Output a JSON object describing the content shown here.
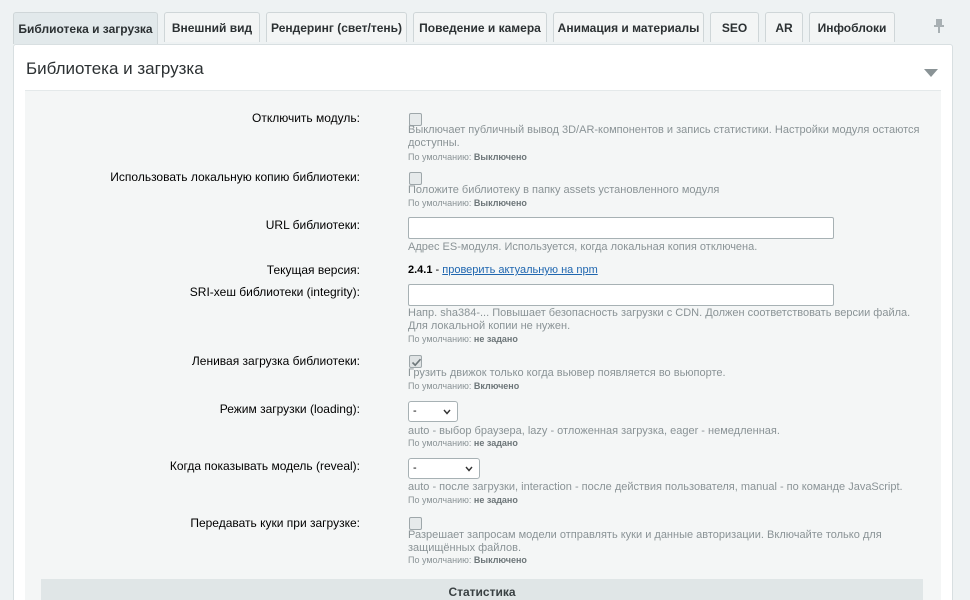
{
  "tabs": [
    {
      "label": "Библиотека и загрузка",
      "active": true
    },
    {
      "label": "Внешний вид"
    },
    {
      "label": "Рендеринг (свет/тень)"
    },
    {
      "label": "Поведение и камера"
    },
    {
      "label": "Анимация и материалы"
    },
    {
      "label": "SEO"
    },
    {
      "label": "AR"
    },
    {
      "label": "Инфоблоки"
    }
  ],
  "panel": {
    "title": "Библиотека и загрузка"
  },
  "default_prefix": "По умолчанию:",
  "fields": {
    "disable_module": {
      "label": "Отключить модуль:",
      "checked": false,
      "desc": "Выключает публичный вывод 3D/AR-компонентов и запись статистики. Настройки модуля остаются доступны.",
      "default": "Выключено"
    },
    "local_copy": {
      "label": "Использовать локальную копию библиотеки:",
      "checked": false,
      "desc": "Положите библиотеку в папку assets установленного модуля",
      "default": "Выключено"
    },
    "library_url": {
      "label": "URL библиотеки:",
      "value": "",
      "desc": "Адрес ES-модуля. Используется, когда локальная копия отключена."
    },
    "current_version": {
      "label": "Текущая версия:",
      "version": "2.4.1",
      "separator": " - ",
      "link": "проверить актуальную на npm"
    },
    "sri_hash": {
      "label": "SRI-хеш библиотеки (integrity):",
      "value": "",
      "desc": "Напр. sha384-... Повышает безопасность загрузки с CDN. Должен соответствовать версии файла. Для локальной копии не нужен.",
      "default": "не задано"
    },
    "lazy_load": {
      "label": "Ленивая загрузка библиотеки:",
      "checked": true,
      "desc": "Грузить движок только когда вьювер появляется во вьюпорте.",
      "default": "Включено"
    },
    "loading_mode": {
      "label": "Режим загрузки (loading):",
      "selected": "-",
      "desc": "auto - выбор браузера, lazy - отложенная загрузка, eager - немедленная.",
      "default": "не задано"
    },
    "reveal": {
      "label": "Когда показывать модель (reveal):",
      "selected": "-",
      "desc": "auto - после загрузки, interaction - после действия пользователя, manual - по команде JavaScript.",
      "default": "не задано"
    },
    "cookies": {
      "label": "Передавать куки при загрузке:",
      "checked": false,
      "desc": "Разрешает запросам модели отправлять куки и данные авторизации. Включайте только для защищённых файлов.",
      "default": "Выключено"
    }
  },
  "sections": {
    "statistics": "Статистика"
  },
  "icons": {
    "pin": "pin-icon",
    "collapse": "triangle-down-icon",
    "check": "check-icon",
    "select_arrow": "chevron-down-icon"
  }
}
